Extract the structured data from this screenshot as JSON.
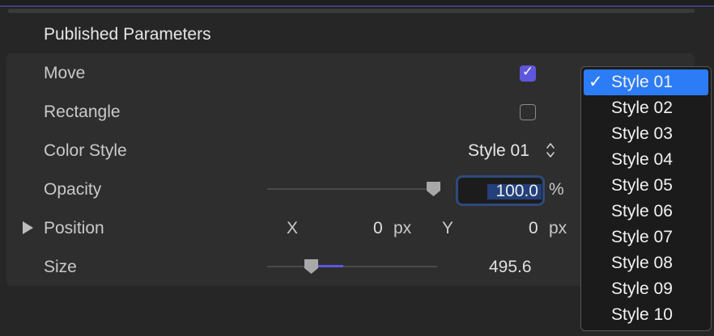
{
  "section": {
    "title": "Published Parameters"
  },
  "params": {
    "move": {
      "label": "Move",
      "checked": true,
      "check_glyph": "✓"
    },
    "rectangle": {
      "label": "Rectangle",
      "checked": false
    },
    "color_style": {
      "label": "Color Style",
      "value": "Style 01",
      "icon": "chevron-updown-icon"
    },
    "opacity": {
      "label": "Opacity",
      "value": "100.0",
      "unit": "%",
      "slider_level_percent": 100
    },
    "position": {
      "label": "Position",
      "x_label": "X",
      "x_value": "0",
      "x_unit": "px",
      "y_label": "Y",
      "y_value": "0",
      "y_unit": "px",
      "icon": "disclosure-triangle-icon"
    },
    "size": {
      "label": "Size",
      "value": "495.6"
    }
  },
  "dropdown": {
    "selected_index": 0,
    "check_glyph": "✓",
    "options": [
      "Style 01",
      "Style 02",
      "Style 03",
      "Style 04",
      "Style 05",
      "Style 06",
      "Style 07",
      "Style 08",
      "Style 09",
      "Style 10"
    ]
  },
  "colors": {
    "accent": "#5e57dc",
    "selection": "#2c7cf6",
    "background": "#262626",
    "panel": "#2e2e2e"
  }
}
